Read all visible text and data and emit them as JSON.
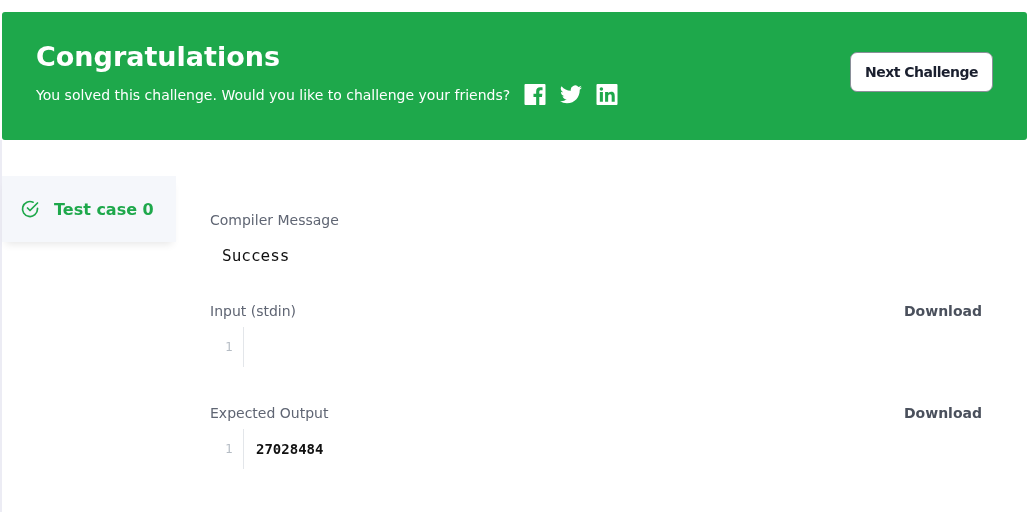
{
  "banner": {
    "title": "Congratulations",
    "message": "You solved this challenge. Would you like to challenge your friends?",
    "button": "Next Challenge"
  },
  "test_cases": [
    {
      "label": "Test case 0",
      "selected": true,
      "passed": true
    }
  ],
  "sections": [
    {
      "kind": "message",
      "label": "Compiler Message",
      "text": "Success"
    },
    {
      "kind": "code",
      "label": "Input (stdin)",
      "action": "Download",
      "lines": [
        {
          "number": "1"
        }
      ]
    },
    {
      "kind": "code",
      "label": "Expected Output",
      "action": "Download",
      "lines": [
        {
          "number": "1",
          "text": "27028484"
        }
      ]
    }
  ]
}
